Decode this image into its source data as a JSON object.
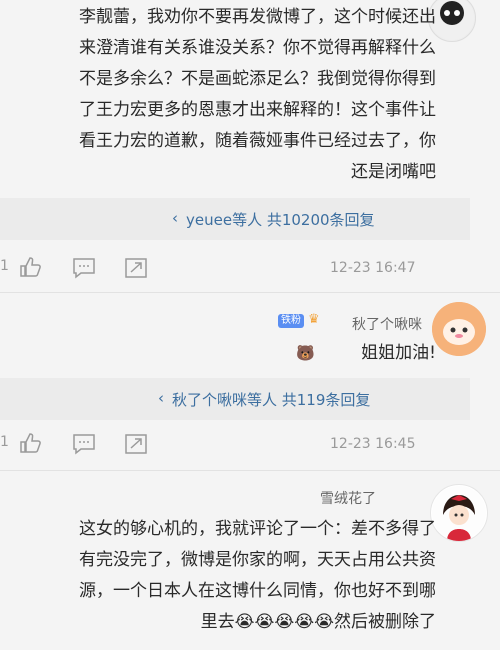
{
  "comment1": {
    "lines": [
      "李靓蕾，我劝你不要再发微博了，这个时候还出",
      "来澄清谁有关系谁没关系？你不觉得再解释什么",
      "不是多余么？不是画蛇添足么？我倒觉得你得到",
      "了王力宏更多的恩惠才出来解释的！这个事件让",
      "看王力宏的道歉，随着薇娅事件已经过去了，你",
      "还是闭嘴吧"
    ],
    "reply_summary": "yeuee等人 共10200条回复",
    "time": "12-23 16:47",
    "like_count": "1"
  },
  "comment2": {
    "username": "秋了个啾咪",
    "badge": "铁粉",
    "text": "姐姐加油!",
    "reply_summary": "秋了个啾咪等人 共119条回复",
    "time": "12-23 16:45",
    "like_count": "1"
  },
  "comment3": {
    "username": "雪绒花了",
    "lines": [
      "这女的够心机的，我就评论了一个：差不多得了",
      "有完没完了，微博是你家的啊，天天占用公共资",
      "源，一个日本人在这博什么同情，你也好不到哪",
      "里去😭😭😭😭😭然后被删除了"
    ]
  },
  "colors": {
    "link": "#3d6fa0",
    "meta": "#9a9a9a",
    "badge": "#5a8ef2"
  }
}
